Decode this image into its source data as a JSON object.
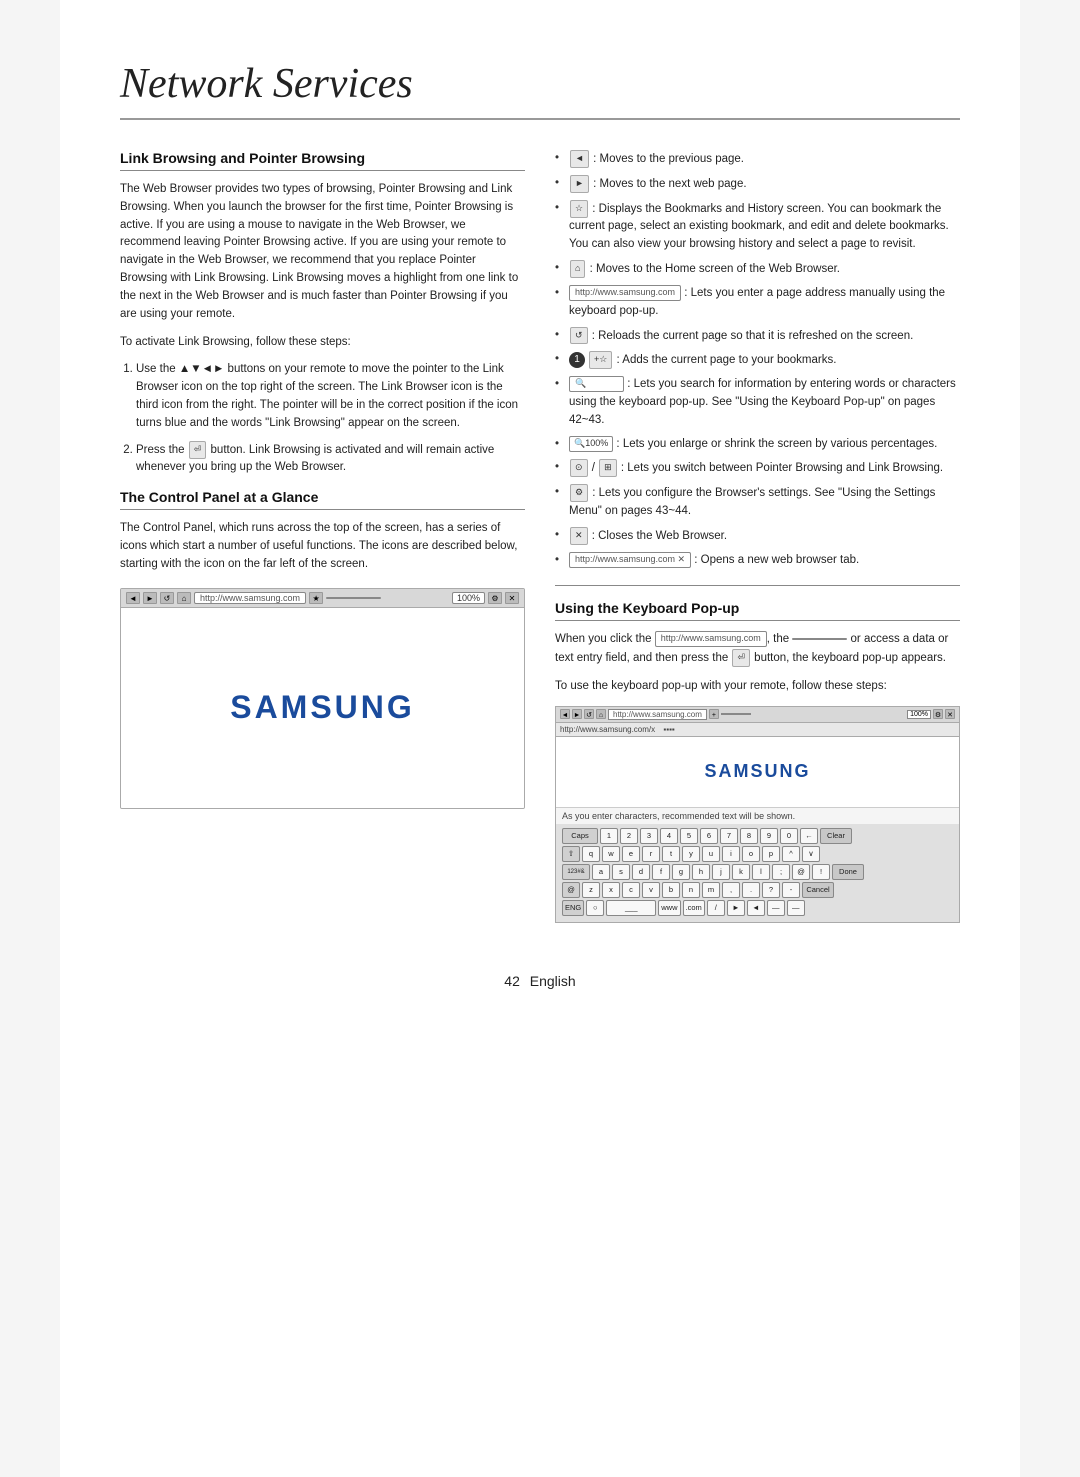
{
  "page": {
    "title": "Network Services",
    "footer": "42  English"
  },
  "left_col": {
    "section1": {
      "title": "Link Browsing and Pointer Browsing",
      "body": "The Web Browser provides two types of browsing, Pointer Browsing and Link Browsing. When you launch the browser for the first time, Pointer Browsing is active. If you are using a mouse to navigate in the Web Browser, we recommend leaving Pointer Browsing active. If you are using your remote to navigate in the Web Browser, we recommend that you replace Pointer Browsing with Link Browsing. Link Browsing moves a highlight from one link to the next in the Web Browser and is much faster than Pointer Browsing if you are using your remote.",
      "activate_text": "To activate Link Browsing, follow these steps:",
      "steps": [
        "Use the ▲▼◄► buttons on your remote to move the pointer to the Link Browser icon on the top right of the screen. The Link Browser icon is the third icon from the right. The pointer will be in the correct position if the icon turns blue and the words \"Link Browsing\" appear on the screen.",
        "Press the  button. Link Browsing is activated and will remain active whenever you bring up the Web Browser."
      ]
    },
    "section2": {
      "title": "The Control Panel at a Glance",
      "body": "The Control Panel, which runs across the top of the screen, has a series of icons which start a number of useful functions. The icons are described below, starting with the icon on the far left of the screen."
    }
  },
  "right_col": {
    "bullets": [
      ": Moves to the previous page.",
      ": Moves to the next web page.",
      ": Displays the Bookmarks and History screen. You can bookmark the current page, select an existing bookmark, and edit and delete bookmarks. You can also view your browsing history and select a page to revisit.",
      ": Moves to the Home screen of the Web Browser.",
      ": Lets you enter a page address manually using the keyboard pop-up.",
      ": Reloads the current page so that it is refreshed on the screen.",
      ": Adds the current page to your bookmarks.",
      ": Lets you search for information by entering words or characters using the keyboard pop-up. See \"Using the Keyboard Pop-up\" on pages 42~43.",
      ": Lets you enlarge or shrink the screen by various percentages.",
      "/ : Lets you switch between Pointer Browsing and Link Browsing.",
      ": Lets you configure the Browser's settings. See \"Using the Settings Menu\" on pages 43~44.",
      ": Closes the Web Browser.",
      ": Opens a new web browser tab."
    ],
    "section3": {
      "title": "Using the Keyboard Pop-up",
      "body1": "When you click the  , the",
      "body2": "or access a data or text entry field, and then press the  button, the keyboard pop-up appears.",
      "body3": "To use the keyboard pop-up with your remote, follow these steps:"
    }
  },
  "browser_mockup": {
    "nav_buttons": [
      "◄",
      "►",
      "↺"
    ],
    "url": "http://www.samsung.com",
    "samsung_text": "SAMSUNG"
  },
  "keyboard_mockup": {
    "url": "http://www.samsung.com",
    "tab_label": "http://www.samsung.com/x",
    "samsung_text": "SAMSUNG",
    "hint_text": "As you enter characters, recommended text will be shown.",
    "rows": [
      [
        "Caps",
        "1",
        "2",
        "3",
        "4",
        "5",
        "6",
        "7",
        "8",
        "9",
        "0",
        "←",
        "Clear"
      ],
      [
        "⇧",
        "q",
        "w",
        "e",
        "r",
        "t",
        "y",
        "u",
        "i",
        "o",
        "p",
        "^",
        "∨"
      ],
      [
        "123#&",
        "a",
        "s",
        "d",
        "f",
        "g",
        "h",
        "j",
        "k",
        "l",
        ";",
        "@",
        "!",
        "Done"
      ],
      [
        "@",
        "z",
        "x",
        "c",
        "v",
        "b",
        "n",
        "m",
        ",",
        ".",
        "?",
        "-",
        "Cancel"
      ],
      [
        "ENG",
        "○",
        "",
        "_____",
        "www",
        ".com",
        "/",
        "►",
        "◄",
        "—",
        "—"
      ]
    ]
  }
}
